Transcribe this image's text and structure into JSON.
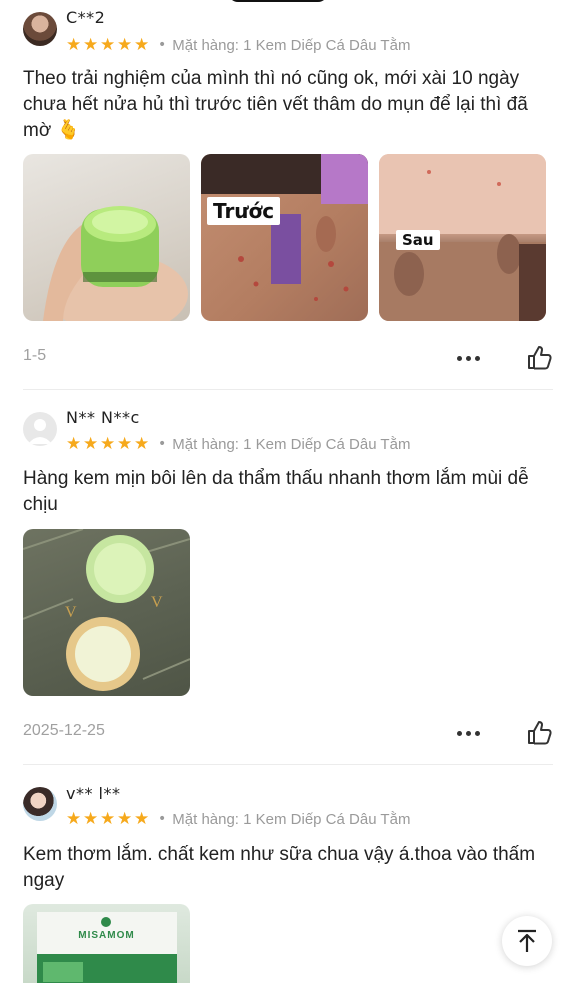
{
  "reviews": [
    {
      "username": "C**2",
      "stars": "★★★★★",
      "variant": "Mặt hàng: 1 Kem Diếp Cá Dâu Tằm",
      "text": "Theo trải nghiệm của mình thì nó cũng ok, mới xài 10 ngày chưa hết nửa hủ thì trước tiên vết thâm do mụn để lại thì đã mờ 🫰",
      "photos": [
        {
          "name": "jar-in-hand"
        },
        {
          "name": "before",
          "overlay": "Trước"
        },
        {
          "name": "after",
          "overlay": "Sau"
        }
      ],
      "date": "1-5"
    },
    {
      "username": "N** N**c",
      "stars": "★★★★★",
      "variant": "Mặt hàng: 1 Kem Diếp Cá Dâu Tằm",
      "text": "Hàng kem mịn bôi lên da thẩm thấu nhanh thơm lắm mùi dễ chịu",
      "photos": [
        {
          "name": "open-jars"
        }
      ],
      "date": "2025-12-25"
    },
    {
      "username": "v** l**",
      "stars": "★★★★★",
      "variant": "Mặt hàng: 1 Kem Diếp Cá Dâu Tằm",
      "text": "Kem thơm lắm. chất kem như sữa chua vậy á.thoa vào thấm ngay",
      "photos": [
        {
          "name": "product-box",
          "brand": "MISAMOM"
        }
      ],
      "date": ""
    }
  ],
  "icons": {
    "more": "more-horizontal-icon",
    "like": "thumbs-up-icon",
    "back_to_top": "arrow-up-icon"
  },
  "colors": {
    "star": "#f6a91c",
    "muted": "#9a9a9a",
    "text": "#222222"
  }
}
